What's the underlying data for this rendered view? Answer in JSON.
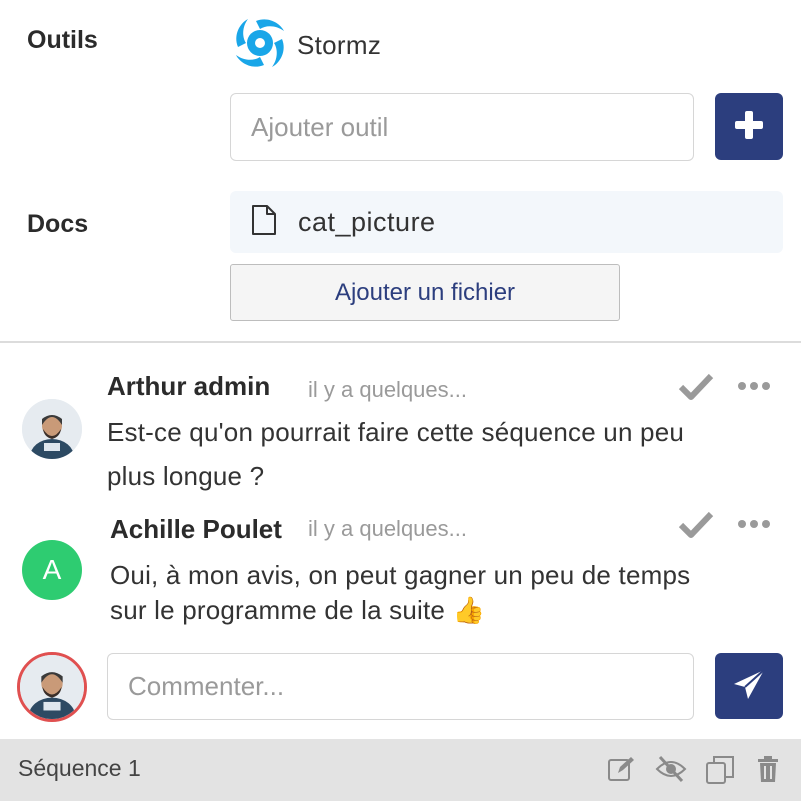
{
  "tools": {
    "label": "Outils",
    "items": [
      {
        "name": "Stormz",
        "icon": "stormz-logo-icon"
      }
    ],
    "input_placeholder": "Ajouter outil",
    "add_icon": "plus-icon"
  },
  "docs": {
    "label": "Docs",
    "items": [
      {
        "name": "cat_picture",
        "icon": "file-icon"
      }
    ],
    "add_button_label": "Ajouter un fichier"
  },
  "comments": [
    {
      "author": "Arthur admin",
      "time": "il y a quelques...",
      "text_line1": "Est-ce qu'on pourrait faire cette séquence un peu",
      "text_line2": "plus longue ?",
      "avatar": "photo"
    },
    {
      "author": "Achille Poulet",
      "time": "il y a quelques...",
      "text_line1": "Oui, à mon avis, on peut gagner un peu de temps",
      "text_line2": "sur le programme de la suite 👍",
      "avatar_letter": "A"
    }
  ],
  "composer": {
    "placeholder": "Commenter...",
    "send_icon": "paper-plane-icon"
  },
  "footer": {
    "title": "Séquence 1",
    "icons": [
      "edit-icon",
      "eye-slash-icon",
      "duplicate-icon",
      "trash-icon"
    ]
  },
  "colors": {
    "primary": "#2c3e7e",
    "avatar_green": "#2ecc71",
    "own_avatar_ring": "#e05050",
    "doc_bg": "#f3f7fb",
    "footer_bg": "#e3e3e3",
    "stormz_blue": "#19a6e8"
  }
}
